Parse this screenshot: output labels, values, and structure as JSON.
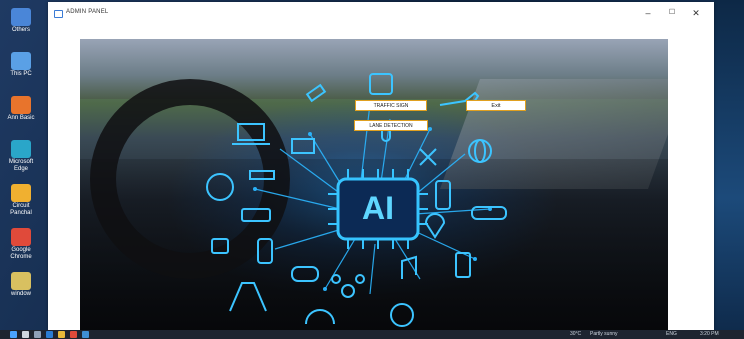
{
  "window": {
    "title": "ADMIN PANEL",
    "minimize": "–",
    "maximize": "☐",
    "close": "✕"
  },
  "desktop_icons": [
    {
      "label": "Others",
      "color": "#4a86d8"
    },
    {
      "label": "This PC",
      "color": "#5aa0e6"
    },
    {
      "label": "Ann Basic",
      "color": "#e8742c"
    },
    {
      "label": "Microsoft Edge",
      "color": "#2aa6c9"
    },
    {
      "label": "Circuit Panchal",
      "color": "#f0b030"
    },
    {
      "label": "Google Chrome",
      "color": "#e04a3a"
    },
    {
      "label": "window",
      "color": "#d8c060"
    }
  ],
  "buttons": {
    "traffic_sign": "TRAFFIC SIGN",
    "lane_detection": "LANE DETECTION",
    "exit": "Exit"
  },
  "ai_chip_text": "AI",
  "taskbar": {
    "weather": "30°C",
    "weather_desc": "Partly sunny",
    "lang": "ENG",
    "time": "3:20 PM"
  }
}
